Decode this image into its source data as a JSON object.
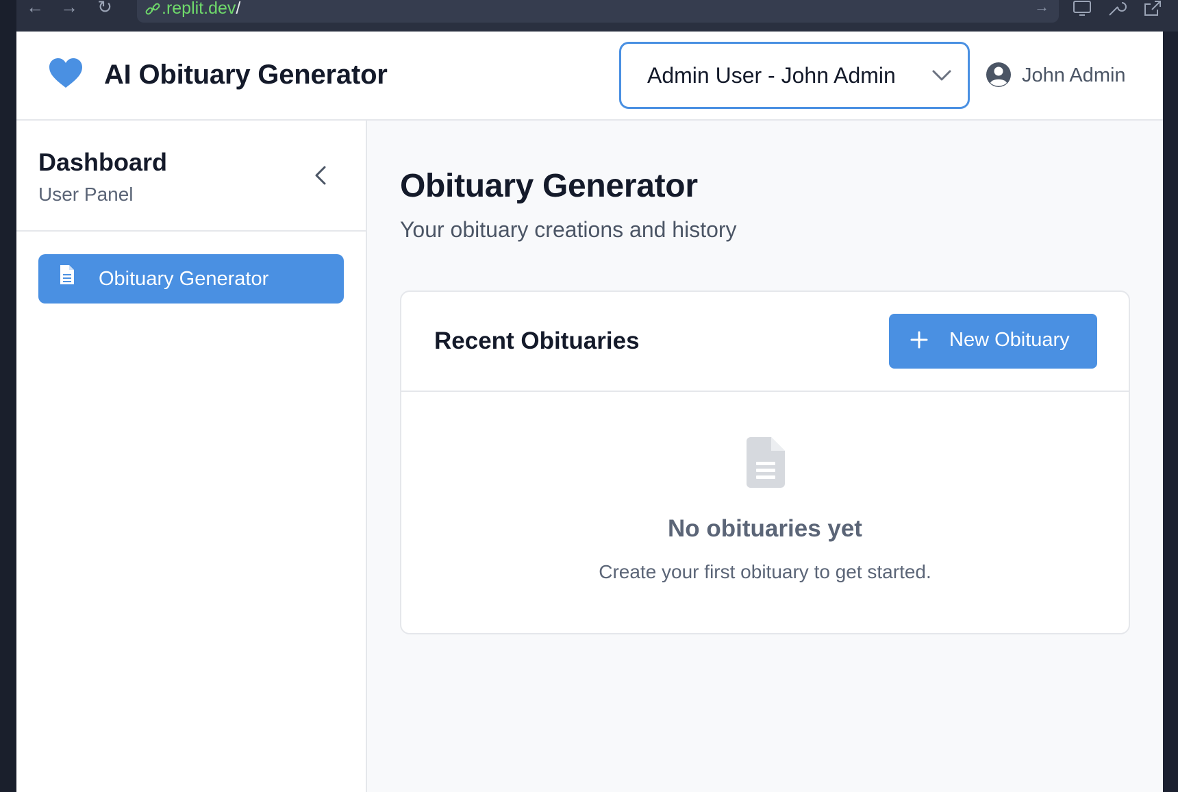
{
  "browser": {
    "url_domain": ".replit.dev",
    "url_path": "/"
  },
  "header": {
    "app_title": "AI Obituary Generator",
    "role_select": {
      "selected": "Admin User - John Admin"
    },
    "user_name": "John Admin",
    "accent_color": "#4a90e2"
  },
  "sidebar": {
    "title": "Dashboard",
    "subtitle": "User Panel",
    "items": [
      {
        "label": "Obituary Generator",
        "icon": "document-icon",
        "active": true
      }
    ]
  },
  "main": {
    "title": "Obituary Generator",
    "subtitle": "Your obituary creations and history",
    "card": {
      "title": "Recent Obituaries",
      "new_button_label": "New Obituary",
      "empty_title": "No obituaries yet",
      "empty_desc": "Create your first obituary to get started."
    }
  }
}
